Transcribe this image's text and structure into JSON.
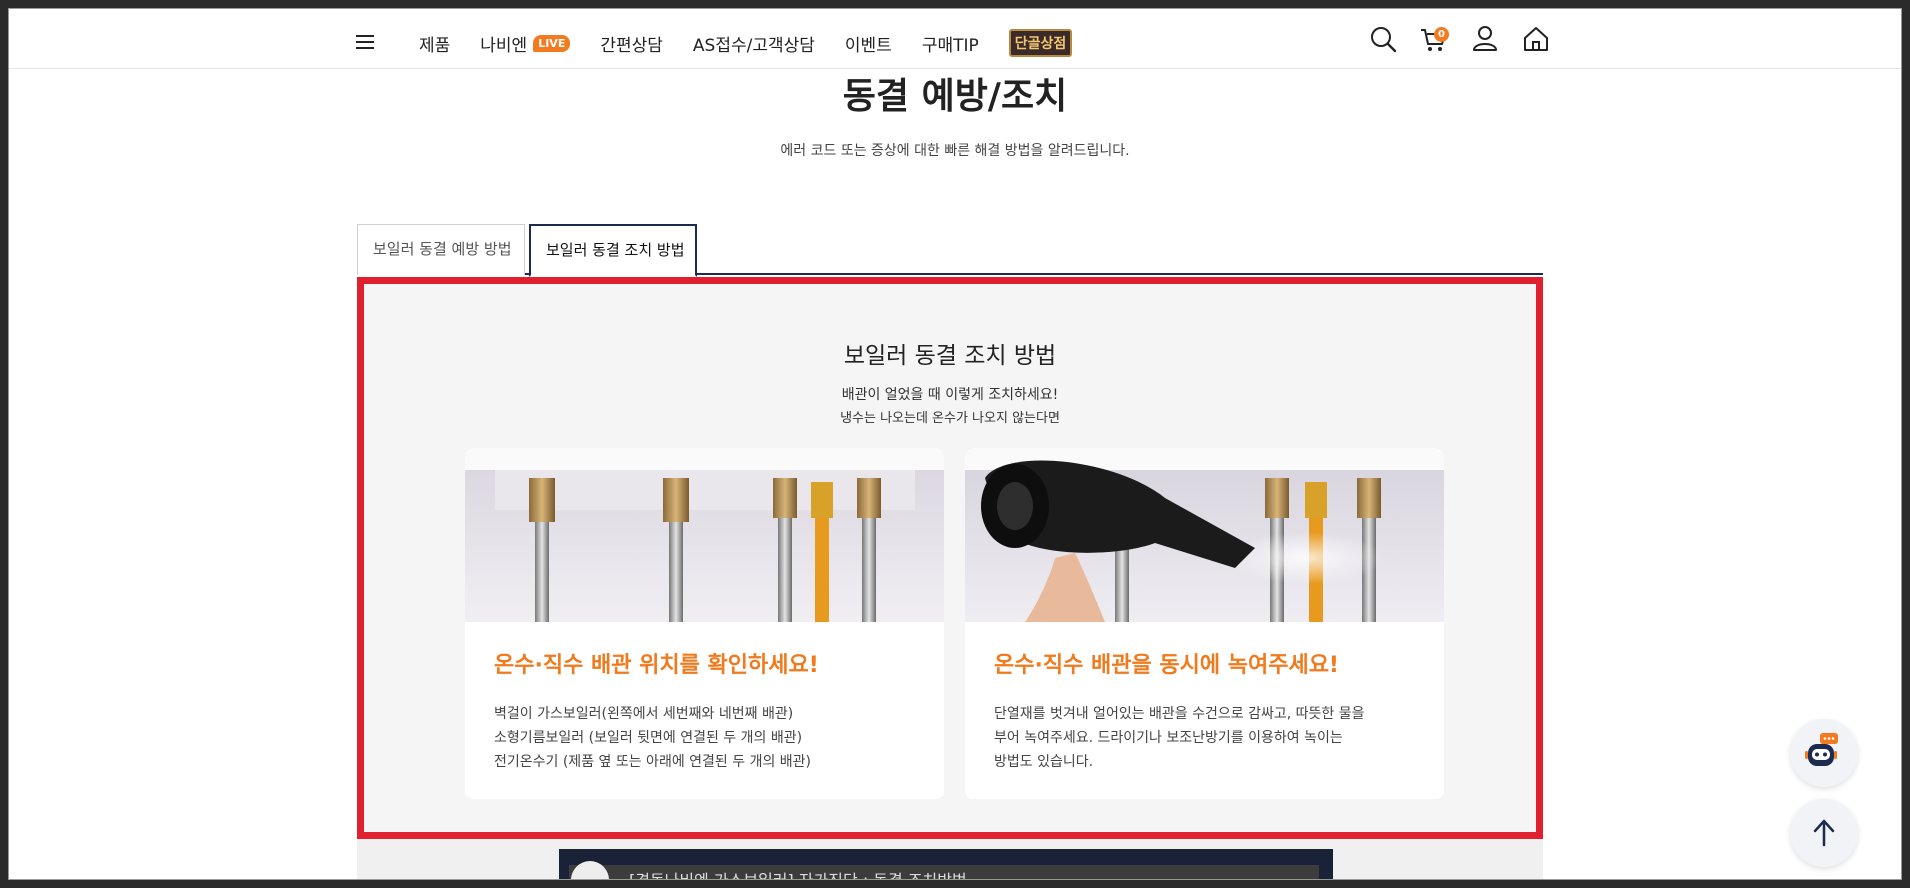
{
  "header": {
    "nav": [
      "제품",
      "나비엔",
      "간편상담",
      "AS접수/고객상담",
      "이벤트",
      "구매TIP"
    ],
    "live_badge": "LIVE",
    "tanggol_label": "단골상점",
    "cart_count": "0"
  },
  "page": {
    "title": "동결 예방/조치",
    "subtitle": "에러 코드 또는 증상에 대한 빠른 해결 방법을 알려드립니다."
  },
  "tabs": [
    {
      "label": "보일러 동결 예방 방법",
      "active": false
    },
    {
      "label": "보일러 동결 조치 방법",
      "active": true
    }
  ],
  "panel": {
    "title": "보일러 동결 조치 방법",
    "sub1": "배관이 얼었을 때 이렇게 조치하세요!",
    "sub2": "냉수는 나오는데 온수가 나오지 않는다면",
    "cards": [
      {
        "title": "온수·직수 배관 위치를 확인하세요!",
        "lines": [
          "벽걸이 가스보일러(왼쪽에서 세번째와 네번째 배관)",
          "소형기름보일러 (보일러 뒷면에 연결된 두 개의 배관)",
          "전기온수기 (제품 옆 또는 아래에 연결된 두 개의 배관)"
        ]
      },
      {
        "title": "온수·직수 배관을 동시에 녹여주세요!",
        "lines": [
          "단열재를 벗겨내 얼어있는 배관을 수건으로 감싸고, 따뜻한 물을",
          "부어 녹여주세요. 드라이기나 보조난방기를 이용하여 녹이는",
          "방법도 있습니다."
        ]
      }
    ]
  },
  "video": {
    "title": "[경동나비엔 가스보일러] 자가진단 : 동결 조치방법"
  },
  "colors": {
    "accent_orange": "#f07a1d",
    "highlight_red": "#e0202e",
    "navy": "#1d2b4f"
  }
}
